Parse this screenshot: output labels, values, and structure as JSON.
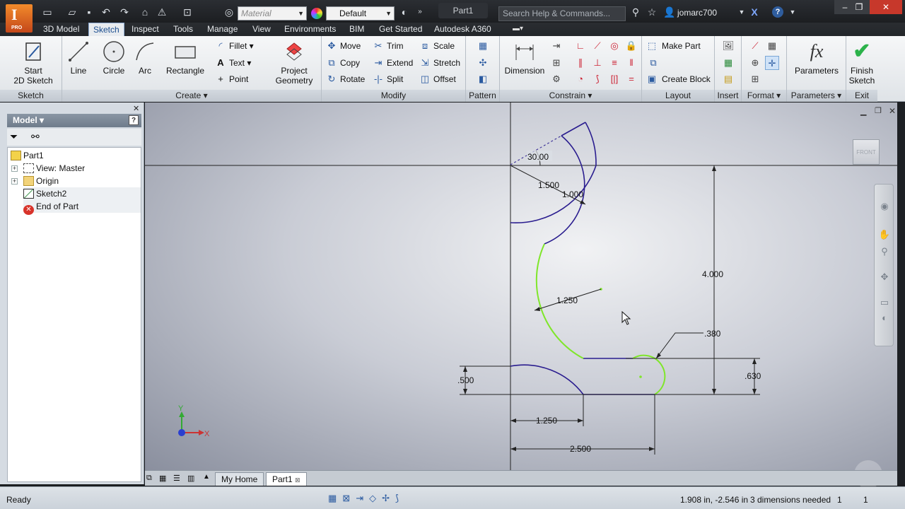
{
  "titlebar": {
    "app_badge": "PRO",
    "material_placeholder": "Material",
    "appearance_value": "Default",
    "doc_title": "Part1",
    "search_placeholder": "Search Help & Commands...",
    "username": "jomarc700"
  },
  "tabs": [
    "3D Model",
    "Sketch",
    "Inspect",
    "Tools",
    "Manage",
    "View",
    "Environments",
    "BIM",
    "Get Started",
    "Autodesk A360"
  ],
  "active_tab": "Sketch",
  "ribbon": {
    "sketch_panel": {
      "label": "Sketch",
      "start_line1": "Start",
      "start_line2": "2D Sketch"
    },
    "create_panel": {
      "label": "Create",
      "line": "Line",
      "circle": "Circle",
      "arc": "Arc",
      "rectangle": "Rectangle",
      "fillet": "Fillet",
      "text": "Text",
      "point": "Point",
      "project_line1": "Project",
      "project_line2": "Geometry"
    },
    "modify_panel": {
      "label": "Modify",
      "move": "Move",
      "trim": "Trim",
      "scale": "Scale",
      "copy": "Copy",
      "extend": "Extend",
      "stretch": "Stretch",
      "rotate": "Rotate",
      "split": "Split",
      "offset": "Offset"
    },
    "pattern_panel": {
      "label": "Pattern"
    },
    "constrain_panel": {
      "label": "Constrain",
      "dimension": "Dimension"
    },
    "layout_panel": {
      "label": "Layout",
      "make_part": "Make Part",
      "create_block": "Create Block"
    },
    "insert_panel": {
      "label": "Insert"
    },
    "format_panel": {
      "label": "Format"
    },
    "parameters_panel": {
      "label": "Parameters",
      "button": "Parameters"
    },
    "exit_panel": {
      "label": "Exit",
      "finish_line1": "Finish",
      "finish_line2": "Sketch"
    }
  },
  "browser": {
    "title": "Model",
    "tree": [
      {
        "label": "Part1"
      },
      {
        "label": "View: Master"
      },
      {
        "label": "Origin"
      },
      {
        "label": "Sketch2"
      },
      {
        "label": "End of Part"
      }
    ]
  },
  "canvas": {
    "viewcube_label": "FRONT",
    "dimensions": {
      "angle": "30.00",
      "radius_outer": "1.500",
      "radius_inner": "1.000",
      "radius_mid": "1.250",
      "height_total": "4.000",
      "radius_small": ".380",
      "height_right": ".630",
      "height_left": ".500",
      "width_inner": "1.250",
      "width_total": "2.500"
    },
    "axis_x": "X",
    "axis_y": "Y"
  },
  "doc_tabs": [
    "My Home",
    "Part1"
  ],
  "status": {
    "ready": "Ready",
    "coords": "1.908 in, -2.546 in",
    "dims_needed": "3 dimensions needed",
    "count1": "1",
    "count2": "1"
  },
  "colors": {
    "sketch_line": "#2a1d8f",
    "unconstrained": "#7fe62a",
    "accent": "#1a4d8f"
  }
}
